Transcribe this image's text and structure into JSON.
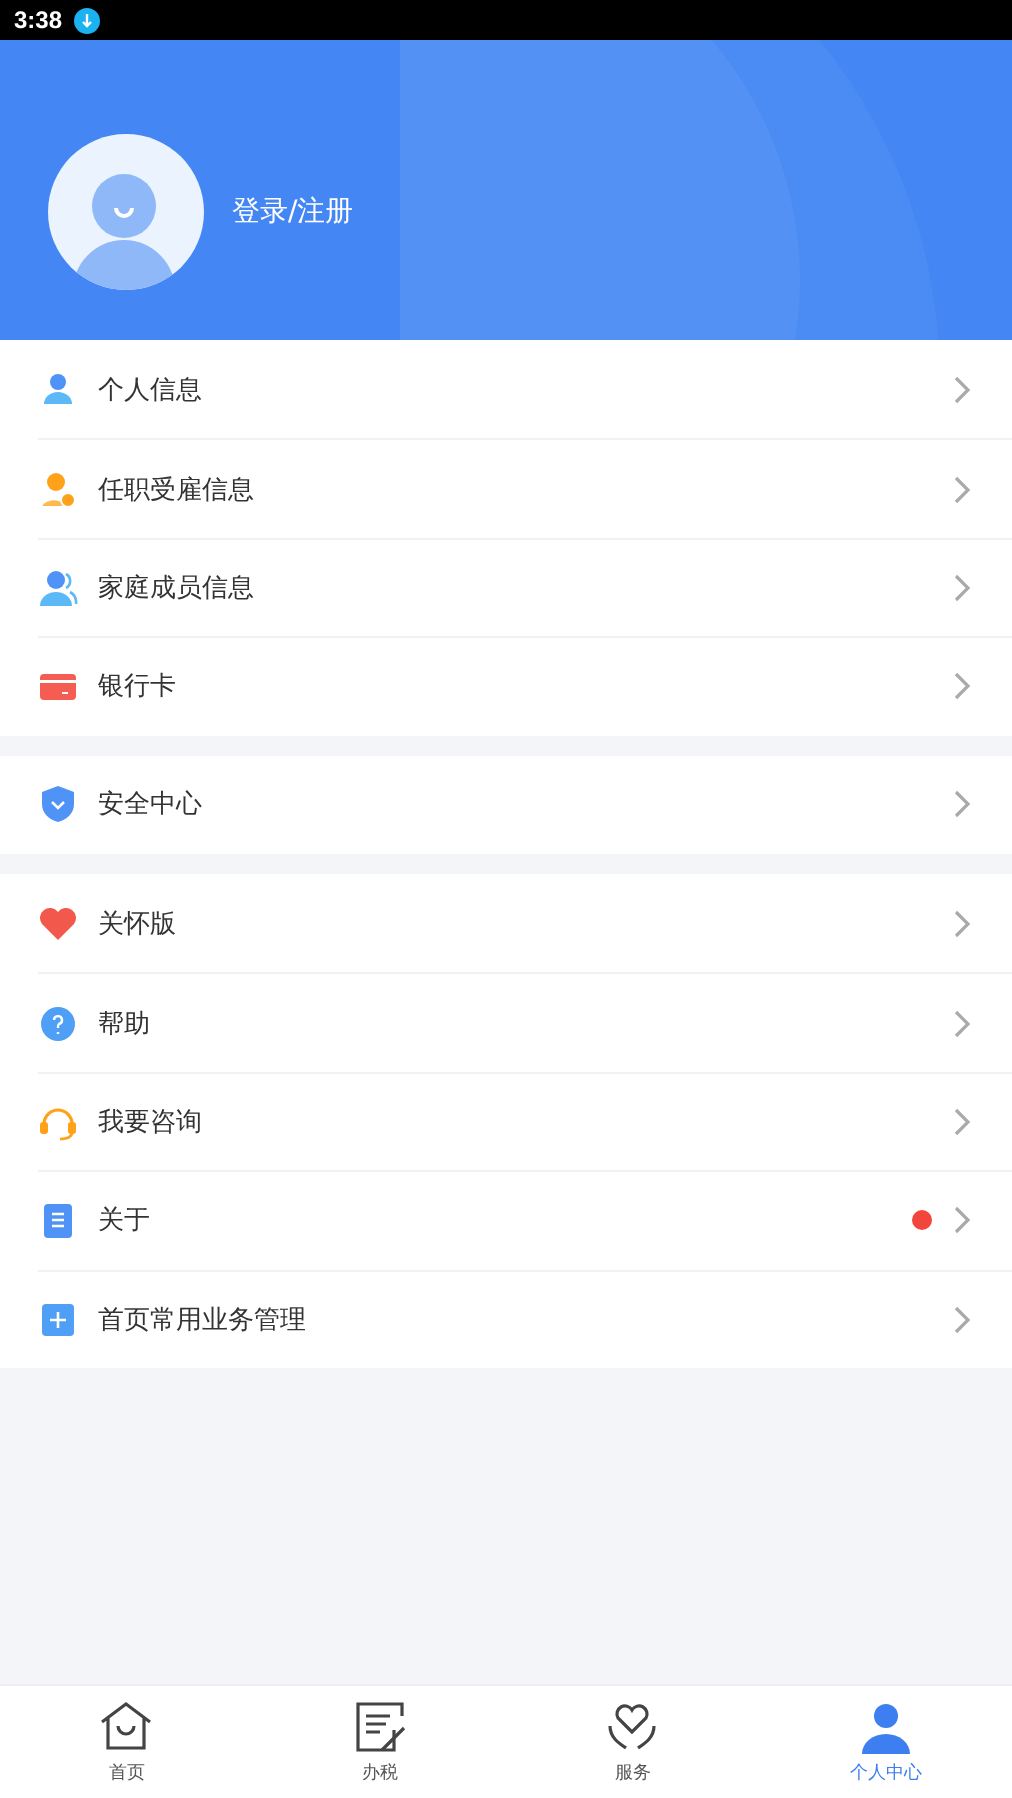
{
  "status_bar": {
    "time": "3:38"
  },
  "profile": {
    "login_label": "登录/注册"
  },
  "groups": [
    {
      "items": [
        {
          "kind": "person",
          "label": "个人信息",
          "dot": false
        },
        {
          "kind": "employment",
          "label": "任职受雇信息",
          "dot": false
        },
        {
          "kind": "family",
          "label": "家庭成员信息",
          "dot": false
        },
        {
          "kind": "card",
          "label": "银行卡",
          "dot": false
        }
      ]
    },
    {
      "items": [
        {
          "kind": "shield",
          "label": "安全中心",
          "dot": false
        }
      ]
    },
    {
      "items": [
        {
          "kind": "heart",
          "label": "关怀版",
          "dot": false
        },
        {
          "kind": "help",
          "label": "帮助",
          "dot": false
        },
        {
          "kind": "headset",
          "label": "我要咨询",
          "dot": false
        },
        {
          "kind": "doc",
          "label": "关于",
          "dot": true
        },
        {
          "kind": "plus",
          "label": "首页常用业务管理",
          "dot": false
        }
      ]
    }
  ],
  "tabs": [
    {
      "kind": "home",
      "label": "首页",
      "selected": false
    },
    {
      "kind": "tax",
      "label": "办税",
      "selected": false
    },
    {
      "kind": "service",
      "label": "服务",
      "selected": false
    },
    {
      "kind": "user",
      "label": "个人中心",
      "selected": true
    }
  ]
}
